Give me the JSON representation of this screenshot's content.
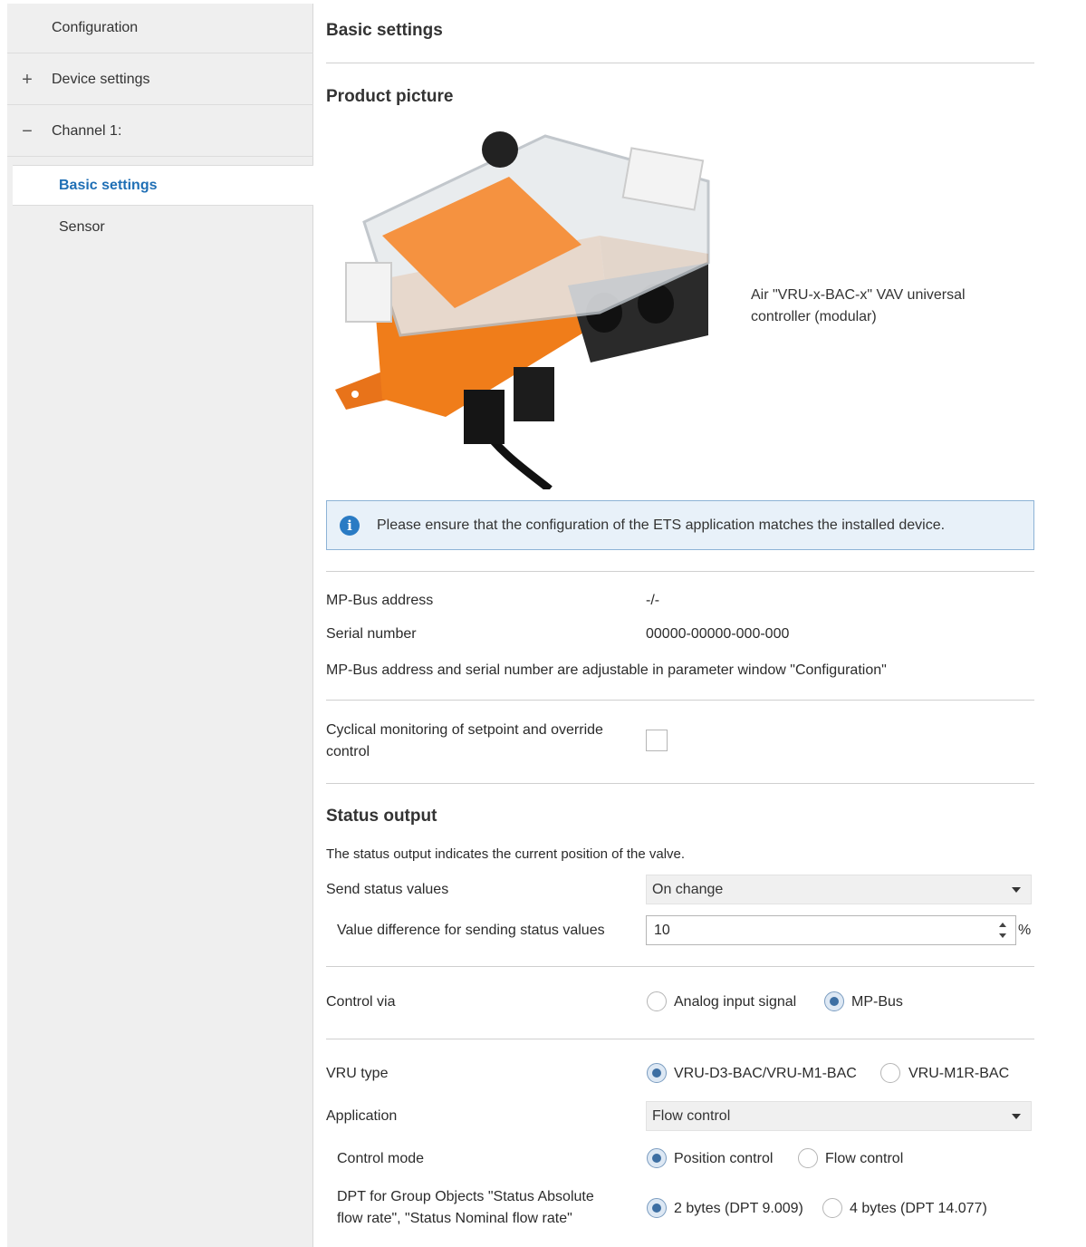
{
  "sidebar": {
    "configuration": "Configuration",
    "device_settings": {
      "sign": "+",
      "label": "Device settings"
    },
    "channel1": {
      "sign": "−",
      "label": "Channel 1:"
    },
    "basic_settings": "Basic settings",
    "sensor": "Sensor"
  },
  "main": {
    "title": "Basic settings",
    "product_picture_title": "Product picture",
    "product_caption": "Air \"VRU-x-BAC-x\" VAV universal controller (modular)",
    "info_text": "Please ensure that the configuration of the ETS application matches the installed device.",
    "mp_bus_address_label": "MP-Bus address",
    "mp_bus_address_value": "-/-",
    "serial_number_label": "Serial number",
    "serial_number_value": "00000-00000-000-000",
    "adjustable_note": "MP-Bus address and serial number are adjustable in parameter window \"Configuration\"",
    "cyclical_label_line1": "Cyclical monitoring of setpoint and override",
    "cyclical_label_line2": "control",
    "status_output_title": "Status output",
    "status_output_desc": "The status output indicates the current position of the valve.",
    "send_status_label": "Send status values",
    "send_status_value": "On change",
    "value_diff_label": "Value difference for sending status values",
    "value_diff_value": "10",
    "value_diff_unit": "%",
    "control_via_label": "Control via",
    "control_via_options": [
      "Analog input signal",
      "MP-Bus"
    ],
    "control_via_selected": "MP-Bus",
    "vru_type_label": "VRU type",
    "vru_type_options": [
      "VRU-D3-BAC/VRU-M1-BAC",
      "VRU-M1R-BAC"
    ],
    "vru_type_selected": "VRU-D3-BAC/VRU-M1-BAC",
    "application_label": "Application",
    "application_value": "Flow control",
    "control_mode_label": "Control mode",
    "control_mode_options": [
      "Position control",
      "Flow control"
    ],
    "control_mode_selected": "Position control",
    "dpt_label_line1": "DPT for Group Objects \"Status Absolute",
    "dpt_label_line2": "flow rate\", \"Status Nominal flow rate\"",
    "dpt_options": [
      "2 bytes (DPT 9.009)",
      "4 bytes (DPT 14.077)"
    ],
    "dpt_selected": "2 bytes (DPT 9.009)"
  },
  "colors": {
    "accent": "#1f6fb5",
    "info_bg": "#e8f1f9",
    "info_border": "#8db3d6",
    "sidebar_bg": "#efefef",
    "actuator_orange": "#f07d1a"
  }
}
